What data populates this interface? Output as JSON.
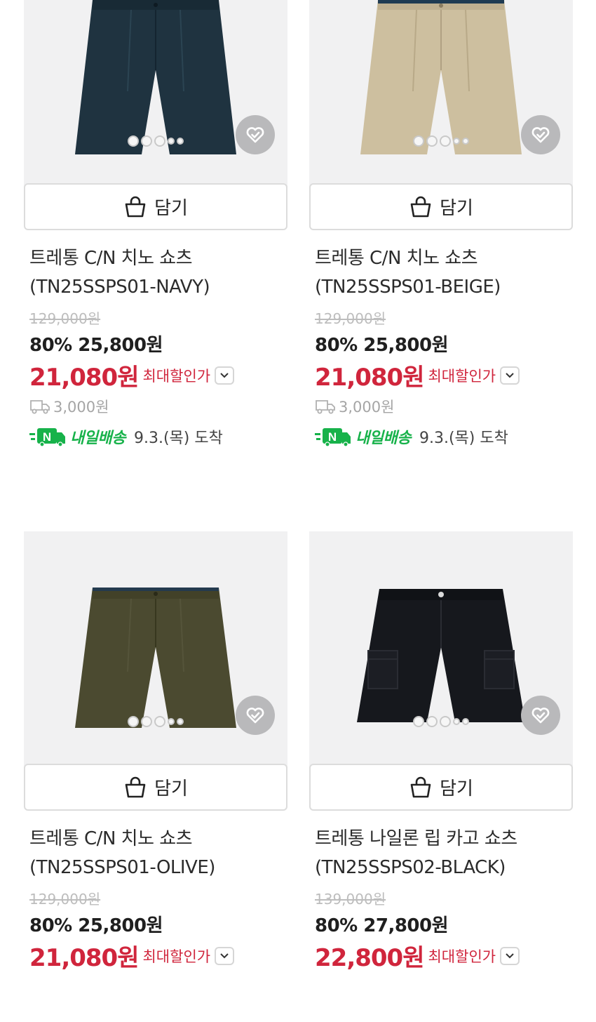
{
  "cart_label": "담기",
  "max_discount_label": "최대할인가",
  "tomorrow_label": "내일배송",
  "tomorrow_badge": "N",
  "products": [
    {
      "name_line1": "트레통 C/N 치노 쇼츠",
      "name_line2": "(TN25SSPS01-NAVY)",
      "original_price": "129,000원",
      "discount_price": "80% 25,800원",
      "max_price": "21,080원",
      "shipping_fee": "3,000원",
      "arrival": "9.3.(목) 도착",
      "color": "#1f3340",
      "type": "chino"
    },
    {
      "name_line1": "트레통 C/N 치노 쇼츠",
      "name_line2": "(TN25SSPS01-BEIGE)",
      "original_price": "129,000원",
      "discount_price": "80% 25,800원",
      "max_price": "21,080원",
      "shipping_fee": "3,000원",
      "arrival": "9.3.(목) 도착",
      "color": "#cdbf9f",
      "type": "chino"
    },
    {
      "name_line1": "트레통 C/N 치노 쇼츠",
      "name_line2": "(TN25SSPS01-OLIVE)",
      "original_price": "129,000원",
      "discount_price": "80% 25,800원",
      "max_price": "21,080원",
      "color": "#4b4a30",
      "type": "chino"
    },
    {
      "name_line1": "트레통 나일론 립 카고 쇼츠",
      "name_line2": "(TN25SSPS02-BLACK)",
      "original_price": "139,000원",
      "discount_price": "80% 27,800원",
      "max_price": "22,800원",
      "color": "#16181d",
      "type": "cargo"
    }
  ]
}
